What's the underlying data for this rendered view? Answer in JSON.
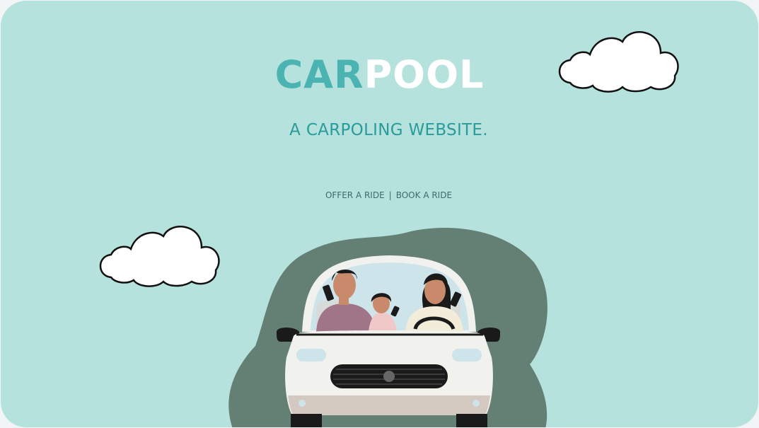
{
  "brand": {
    "logo_part1": "CAR",
    "logo_part2": "POOL"
  },
  "hero": {
    "tagline": "A CARPOLING WEBSITE."
  },
  "nav": {
    "offer_label": "OFFER A RIDE",
    "separator": "|",
    "book_label": "BOOK A RIDE"
  },
  "colors": {
    "background": "#b5e2dc",
    "accent": "#4bb3b1",
    "tagline": "#2a9b9b",
    "blob": "#647f73"
  },
  "illustration": {
    "icons": [
      "cloud-icon",
      "cloud-icon",
      "car-with-family-illustration"
    ]
  }
}
